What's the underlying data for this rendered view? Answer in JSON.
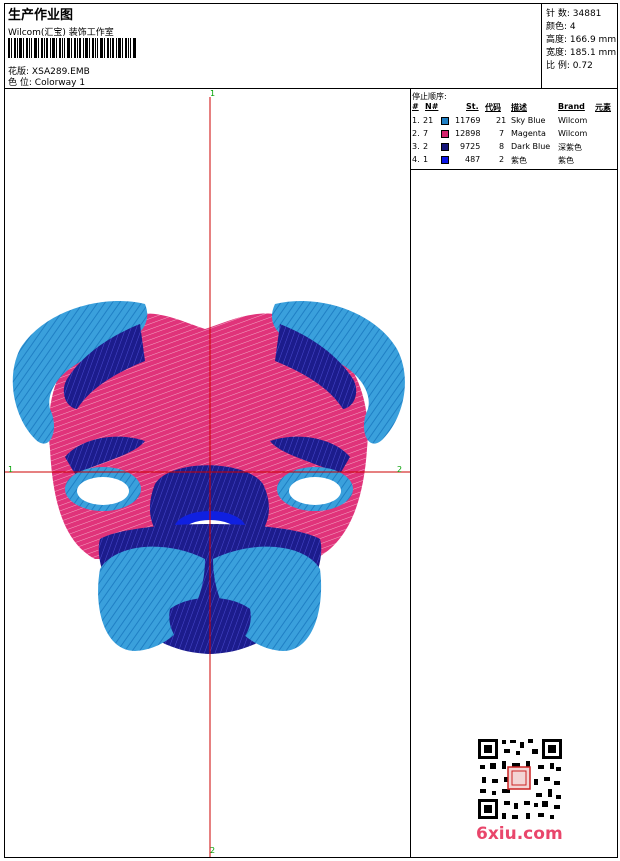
{
  "header": {
    "title": "生产作业图",
    "company": "Wilcom(汇宝) 装饰工作室",
    "pattern_label": "花版:",
    "pattern_value": "XSA289.EMB",
    "colorway_label": "色 位:",
    "colorway_value": "Colorway 1"
  },
  "stats": [
    {
      "label": "针 数:",
      "value": "34881"
    },
    {
      "label": "颜色:",
      "value": "4"
    },
    {
      "label": "高度:",
      "value": "166.9 mm"
    },
    {
      "label": "宽度:",
      "value": "185.1 mm"
    },
    {
      "label": "比 例:",
      "value": "0.72"
    }
  ],
  "thread_table": {
    "title": "停止顺序:",
    "headers": {
      "num": "#",
      "n": "N#",
      "st": "St.",
      "code": "代码",
      "desc": "描述",
      "brand": "Brand",
      "elem": "元素"
    },
    "rows": [
      {
        "num": "1.",
        "n": "21",
        "color": "#1f7fc4",
        "st": "11769",
        "code": "21",
        "desc": "Sky Blue",
        "brand": "Wilcom"
      },
      {
        "num": "2.",
        "n": "7",
        "color": "#d6246e",
        "st": "12898",
        "code": "7",
        "desc": "Magenta",
        "brand": "Wilcom"
      },
      {
        "num": "3.",
        "n": "2",
        "color": "#141478",
        "st": "9725",
        "code": "8",
        "desc": "Dark Blue",
        "brand": "深紫色"
      },
      {
        "num": "4.",
        "n": "1",
        "color": "#0a14e6",
        "st": "487",
        "code": "2",
        "desc": "紫色",
        "brand": "紫色"
      }
    ]
  },
  "axes": {
    "top": "1",
    "left": "1",
    "right": "2",
    "bottom": "2"
  },
  "watermark": "6xiu.com",
  "colors": {
    "sky_blue": "#2a8fcf",
    "magenta": "#e0337a",
    "dark_blue": "#1a1a8a",
    "blue": "#1020e0",
    "crosshair": "#cc0000",
    "axis_label": "#00a000"
  }
}
